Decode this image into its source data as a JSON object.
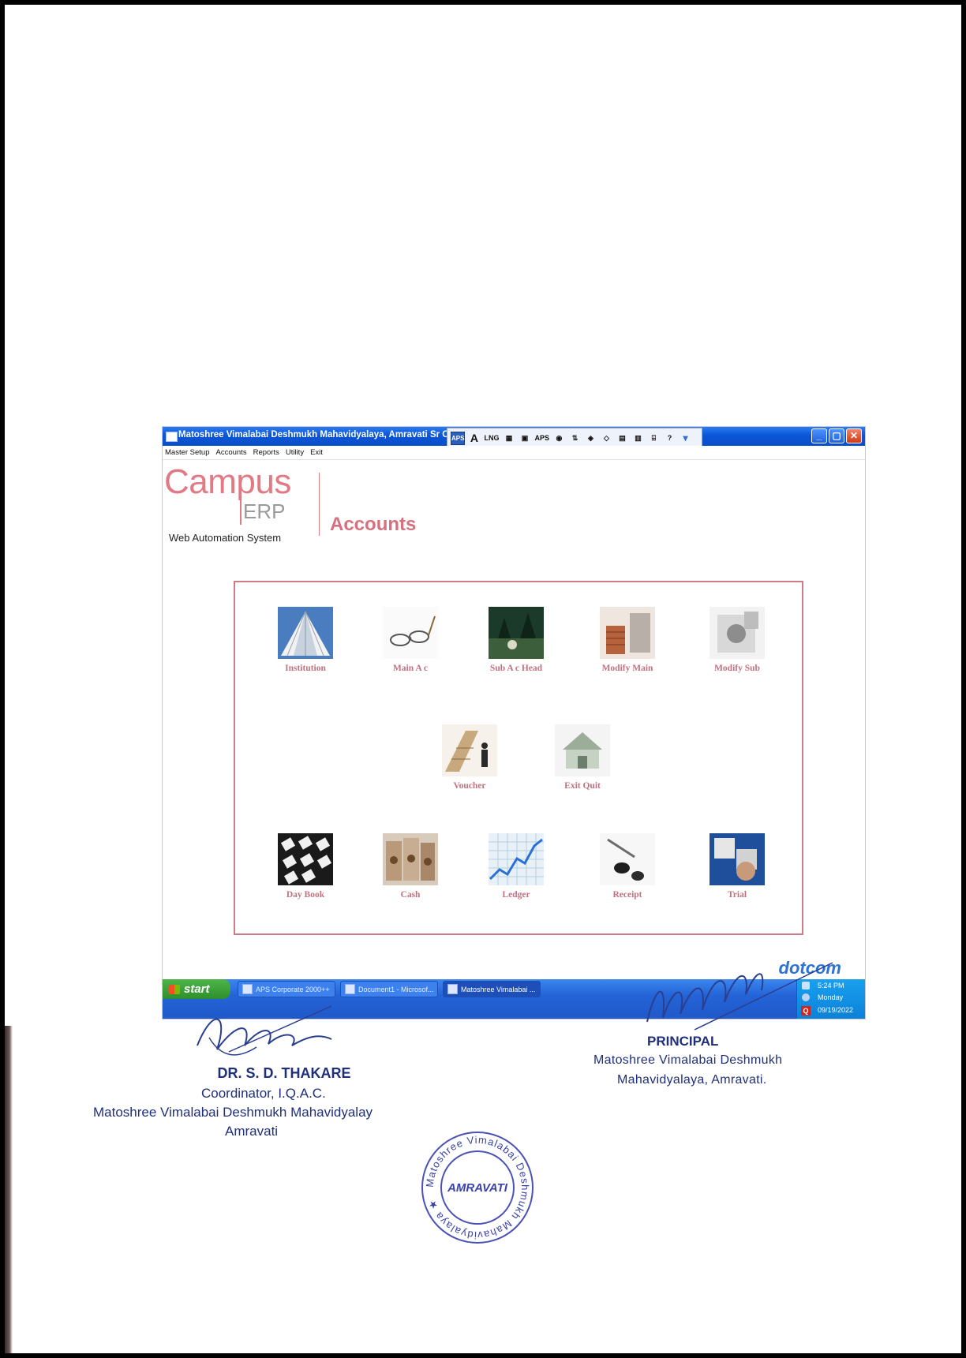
{
  "window": {
    "title": "Matoshree Vimalabai Deshmukh Mahavidyalaya, Amravati Sr Col",
    "controls": {
      "minimize": "_",
      "maximize": "▢",
      "close": "✕"
    }
  },
  "language_bar": {
    "items": [
      "APS",
      "A",
      "LNG",
      "▦",
      "▣",
      "APS",
      "◉",
      "⇅",
      "◈",
      "◇",
      "▤",
      "▥",
      "⌹",
      "?",
      "▾"
    ]
  },
  "menu": [
    "Master Setup",
    "Accounts",
    "Reports",
    "Utility",
    "Exit"
  ],
  "logo": {
    "campus": "Campus",
    "erp": "ERP",
    "tagline": "Web Automation System"
  },
  "section_title": "Accounts",
  "tiles_row1": [
    {
      "label": "Institution",
      "icon": "building-icon"
    },
    {
      "label": "Main A c",
      "icon": "glasses-icon"
    },
    {
      "label": "Sub A c Head",
      "icon": "forest-icon"
    },
    {
      "label": "Modify Main",
      "icon": "coins-stack-icon"
    },
    {
      "label": "Modify Sub",
      "icon": "document-icon"
    }
  ],
  "tiles_row2": [
    {
      "label": "Voucher",
      "icon": "money-stack-icon"
    },
    {
      "label": "Exit Quit",
      "icon": "house-money-icon"
    }
  ],
  "tiles_row3": [
    {
      "label": "Day Book",
      "icon": "keypad-icon"
    },
    {
      "label": "Cash",
      "icon": "banknotes-icon"
    },
    {
      "label": "Ledger",
      "icon": "growth-chart-icon"
    },
    {
      "label": "Receipt",
      "icon": "pen-icon"
    },
    {
      "label": "Trial",
      "icon": "puzzle-icon"
    }
  ],
  "brand": "dotcom",
  "taskbar": {
    "start": "start",
    "tasks": [
      "APS Corporate 2000++",
      "Document1 - Microsof...",
      "Matoshree Vimalabai ..."
    ],
    "clock": {
      "time": "5:24 PM",
      "day": "Monday",
      "date": "09/19/2022"
    },
    "badge": "Q"
  },
  "signature_left": {
    "name": "DR. S. D. THAKARE",
    "role": "Coordinator, I.Q.A.C.",
    "org": "Matoshree Vimalabai Deshmukh Mahavidyalay",
    "city": "Amravati"
  },
  "signature_right": {
    "title": "PRINCIPAL",
    "org": "Matoshree Vimalabai Deshmukh",
    "org2": "Mahavidyalaya, Amravati."
  },
  "stamp": {
    "ring": "Matoshree Vimalabai Deshmukh Mahavidyalaya ★",
    "center": "AMRAVATI"
  }
}
